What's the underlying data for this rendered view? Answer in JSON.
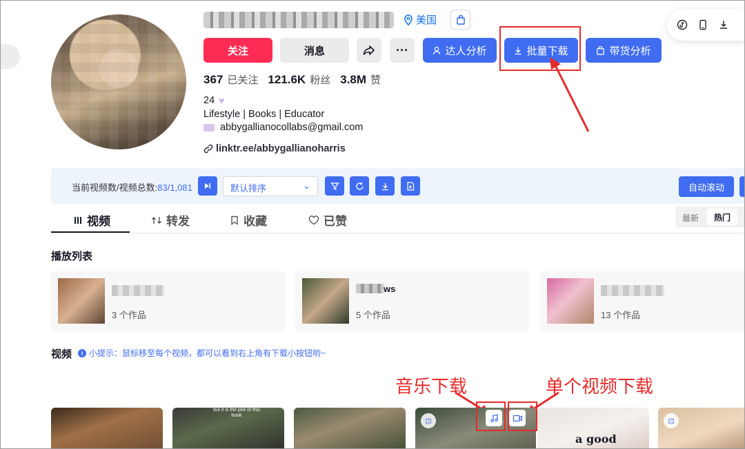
{
  "profile": {
    "location": "美国",
    "stats": [
      {
        "value": "367",
        "label": "已关注"
      },
      {
        "value": "121.6K",
        "label": "粉丝"
      },
      {
        "value": "3.8M",
        "label": "赞"
      }
    ],
    "age_line": "24",
    "bio_line": "Lifestyle | Books | Educator",
    "email": "abbygallianocollabs@gmail.com",
    "link": "linktr.ee/abbygallianoharris"
  },
  "actions": {
    "follow": "关注",
    "message": "消息",
    "more": "···",
    "analysis": "达人分析",
    "batch_download": "批量下载",
    "goods_analysis": "带货分析"
  },
  "control_bar": {
    "count_label": "当前视频数/视频总数:",
    "current": "83",
    "total": "/1,081",
    "sort_value": "默认排序",
    "auto_scroll": "自动滚动"
  },
  "tabs": [
    {
      "label": "视频",
      "icon": "grid-icon"
    },
    {
      "label": "转发",
      "icon": "repost-icon"
    },
    {
      "label": "收藏",
      "icon": "bookmark-icon"
    },
    {
      "label": "已赞",
      "icon": "heart-icon"
    }
  ],
  "sort_toggle": {
    "latest": "最新",
    "popular": "热门"
  },
  "playlists": {
    "title": "播放列表",
    "items": [
      {
        "name": "",
        "count": "3 个作品"
      },
      {
        "name": "ws",
        "count": "5 个作品"
      },
      {
        "name": "",
        "count": "13 个作品"
      }
    ]
  },
  "videos_section": {
    "title": "视频",
    "tip": "小提示：鼠标移至每个视频，都可以看到右上角有下载小按钮哟~",
    "thumb_texts": [
      "but it is the plot of this book",
      "a good"
    ]
  },
  "annotations": {
    "music_download": "音乐下载",
    "single_video_download": "单个视频下载"
  },
  "colors": {
    "accent": "#3f6cf0",
    "follow": "#fe2c55",
    "annotation": "#e62b2b"
  }
}
